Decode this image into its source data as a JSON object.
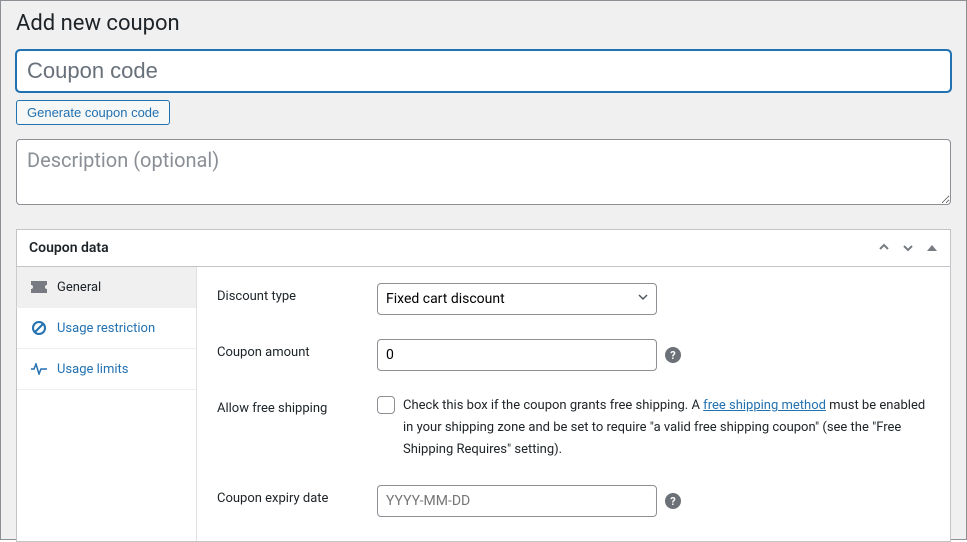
{
  "page": {
    "title": "Add new coupon"
  },
  "coupon_code": {
    "placeholder": "Coupon code",
    "value": ""
  },
  "generate_button": "Generate coupon code",
  "description": {
    "placeholder": "Description (optional)",
    "value": ""
  },
  "panel": {
    "title": "Coupon data"
  },
  "tabs": {
    "general": "General",
    "usage_restriction": "Usage restriction",
    "usage_limits": "Usage limits"
  },
  "fields": {
    "discount_type": {
      "label": "Discount type",
      "value": "Fixed cart discount"
    },
    "coupon_amount": {
      "label": "Coupon amount",
      "value": "0"
    },
    "free_shipping": {
      "label": "Allow free shipping",
      "text_prefix": "Check this box if the coupon grants free shipping. A ",
      "link_text": "free shipping method",
      "text_suffix": " must be enabled in your shipping zone and be set to require \"a valid free shipping coupon\" (see the \"Free Shipping Requires\" setting)."
    },
    "expiry_date": {
      "label": "Coupon expiry date",
      "placeholder": "YYYY-MM-DD",
      "value": ""
    }
  }
}
